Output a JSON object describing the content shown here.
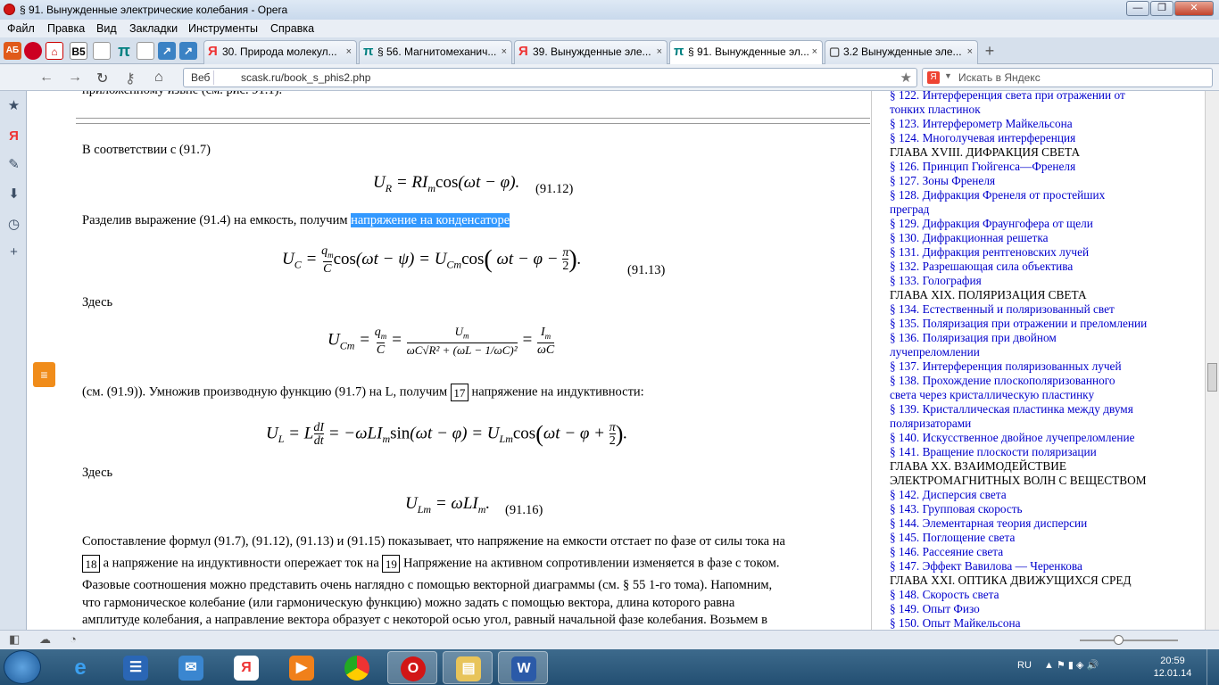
{
  "window": {
    "title": "§ 91. Вынужденные электрические колебания - Opera",
    "min": "—",
    "max": "❐",
    "close": "✕"
  },
  "menu": [
    "Файл",
    "Правка",
    "Вид",
    "Закладки",
    "Инструменты",
    "Справка"
  ],
  "quick_icons": [
    "АБ",
    "",
    "",
    "B5",
    "",
    "π",
    "",
    "",
    ""
  ],
  "tabs": [
    {
      "icon": "Я",
      "label": "30. Природа молекул...",
      "close": "×"
    },
    {
      "icon": "π",
      "label": "§ 56. Магнитомеханич...",
      "close": "×"
    },
    {
      "icon": "Я",
      "label": "39. Вынужденные эле...",
      "close": "×"
    },
    {
      "icon": "π",
      "label": "§ 91. Вынужденные эл...",
      "close": "×",
      "active": true
    },
    {
      "icon": "▢",
      "label": "3.2 Вынужденные эле...",
      "close": "×"
    }
  ],
  "addressbar": {
    "source": "Веб",
    "url": "scask.ru/book_s_phis2.php",
    "search_placeholder": "Искать в Яндекс"
  },
  "content": {
    "top_cut": "приложенному извне (см. рис. 91.1).",
    "p1": "В соответствии с (91.7)",
    "eq12": "(91.12)",
    "p2_before": "Разделив выражение (91.4) на емкость, получим ",
    "p2_selected": "напряжение на конденсаторе",
    "eq13": "(91.13)",
    "p3": "Здесь",
    "p4_before": "(см. (91.9)). Умножив производную функцию (91.7) на L, получим ",
    "ref17": "17",
    "p4_after": " напряжение на индуктивности:",
    "p5": "Здесь",
    "eq16": "(91.16)",
    "p6a": "Сопоставление формул (91.7), (91.12), (91.13) и (91.15) показывает, что напряжение на емкости отстает по фазе от силы тока на",
    "ref18": "18",
    "p6b": " а напряжение на индуктивности опережает ток на ",
    "ref19": "19",
    "p6c": " Напряжение на активном сопротивлении изменяется в фазе с током.",
    "p6d": "Фазовые соотношения можно представить очень наглядно с помощью векторной диаграммы (см. § 55 1-го тома). Напомним,",
    "p6e": "что гармоническое колебание (или гармоническую функцию) можно задать с помощью вектора, длина которого равна",
    "p6f": "амплитуде колебания, а направление вектора образует с некоторой осью угол, равный начальной фазе колебания. Возьмем в"
  },
  "toc": [
    {
      "t": "§ 122. Интерференция света при отражении от",
      "link": true
    },
    {
      "t": "тонких пластинок",
      "link": true
    },
    {
      "t": "§ 123. Интерферометр Майкельсона",
      "link": true
    },
    {
      "t": "§ 124. Многолучевая интерференция",
      "link": true
    },
    {
      "t": "ГЛАВА XVIII. ДИФРАКЦИЯ СВЕТА",
      "link": false
    },
    {
      "t": "§ 126. Принцип Гюйгенса—Френеля",
      "link": true
    },
    {
      "t": "§ 127. Зоны Френеля",
      "link": true
    },
    {
      "t": "§ 128. Дифракция Френеля от простейших",
      "link": true
    },
    {
      "t": "преград",
      "link": true
    },
    {
      "t": "§ 129. Дифракция Фраунгофера от щели",
      "link": true
    },
    {
      "t": "§ 130. Дифракционная решетка",
      "link": true
    },
    {
      "t": "§ 131. Дифракция рентгеновских лучей",
      "link": true
    },
    {
      "t": "§ 132. Разрешающая сила объектива",
      "link": true
    },
    {
      "t": "§ 133. Голография",
      "link": true
    },
    {
      "t": "ГЛАВА XIX. ПОЛЯРИЗАЦИЯ СВЕТА",
      "link": false
    },
    {
      "t": "§ 134. Естественный и поляризованный свет",
      "link": true
    },
    {
      "t": "§ 135. Поляризация при отражении и преломлении",
      "link": true
    },
    {
      "t": "§ 136. Поляризация при двойном",
      "link": true
    },
    {
      "t": "лучепреломлении",
      "link": true
    },
    {
      "t": "§ 137. Интерференция поляризованных лучей",
      "link": true
    },
    {
      "t": "§ 138. Прохождение плоскополяризованного",
      "link": true
    },
    {
      "t": "света через кристаллическую пластинку",
      "link": true
    },
    {
      "t": "§ 139. Кристаллическая пластинка между двумя",
      "link": true
    },
    {
      "t": "поляризаторами",
      "link": true
    },
    {
      "t": "§ 140. Искусственное двойное лучепреломление",
      "link": true
    },
    {
      "t": "§ 141. Вращение плоскости поляризации",
      "link": true
    },
    {
      "t": "ГЛАВА XX. ВЗАИМОДЕЙСТВИЕ",
      "link": false
    },
    {
      "t": "ЭЛЕКТРОМАГНИТНЫХ ВОЛН С ВЕЩЕСТВОМ",
      "link": false
    },
    {
      "t": "§ 142. Дисперсия света",
      "link": true
    },
    {
      "t": "§ 143. Групповая скорость",
      "link": true
    },
    {
      "t": "§ 144. Элементарная теория дисперсии",
      "link": true
    },
    {
      "t": "§ 145. Поглощение света",
      "link": true
    },
    {
      "t": "§ 146. Рассеяние света",
      "link": true
    },
    {
      "t": "§ 147. Эффект Вавилова — Черенкова",
      "link": true
    },
    {
      "t": "ГЛАВА XXI. ОПТИКА ДВИЖУЩИХСЯ СРЕД",
      "link": false
    },
    {
      "t": "§ 148. Скорость света",
      "link": true
    },
    {
      "t": "§ 149. Опыт Физо",
      "link": true
    },
    {
      "t": "§ 150. Опыт Майкельсона",
      "link": true
    }
  ],
  "taskbar": {
    "lang": "RU",
    "time": "20:59",
    "date": "12.01.14"
  },
  "colors": {
    "link": "#0000cc",
    "selection": "#3399ff",
    "opera": "#d21616"
  }
}
